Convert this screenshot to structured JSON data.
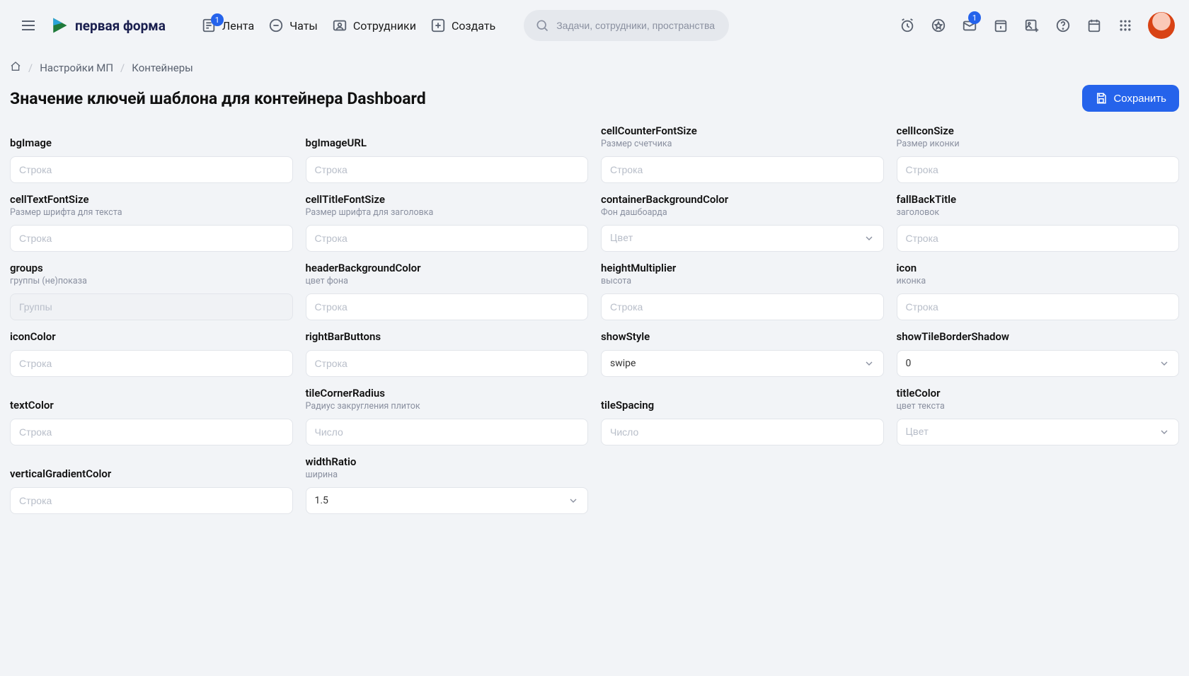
{
  "brand": {
    "name": "первая форма"
  },
  "nav": {
    "feed": {
      "label": "Лента",
      "badge": "1"
    },
    "chats": {
      "label": "Чаты"
    },
    "people": {
      "label": "Сотрудники"
    },
    "create": {
      "label": "Создать"
    }
  },
  "search": {
    "placeholder": "Задачи, сотрудники, пространства"
  },
  "inboxBadge": "1",
  "crumbs": {
    "mp": "Настройки МП",
    "containers": "Контейнеры"
  },
  "page": {
    "title": "Значение ключей шаблона для контейнера Dashboard",
    "saveLabel": "Сохранить"
  },
  "ph": {
    "string": "Строка",
    "number": "Число",
    "color": "Цвет",
    "groups": "Группы"
  },
  "fields": {
    "bgImage": {
      "label": "bgImage"
    },
    "bgImageURL": {
      "label": "bgImageURL"
    },
    "cellCounterFontSize": {
      "label": "cellCounterFontSize",
      "sub": "Размер счетчика"
    },
    "cellIconSize": {
      "label": "cellIconSize",
      "sub": "Размер иконки"
    },
    "cellTextFontSize": {
      "label": "cellTextFontSize",
      "sub": "Размер шрифта для текста"
    },
    "cellTitleFontSize": {
      "label": "cellTitleFontSize",
      "sub": "Размер шрифта для заголовка"
    },
    "containerBackgroundColor": {
      "label": "containerBackgroundColor",
      "sub": "Фон дашбоарда"
    },
    "fallBackTitle": {
      "label": "fallBackTitle",
      "sub": "заголовок"
    },
    "groups": {
      "label": "groups",
      "sub": "группы (не)показа"
    },
    "headerBackgroundColor": {
      "label": "headerBackgroundColor",
      "sub": "цвет фона"
    },
    "heightMultiplier": {
      "label": "heightMultiplier",
      "sub": "высота"
    },
    "icon": {
      "label": "icon",
      "sub": "иконка"
    },
    "iconColor": {
      "label": "iconColor"
    },
    "rightBarButtons": {
      "label": "rightBarButtons"
    },
    "showStyle": {
      "label": "showStyle",
      "value": "swipe"
    },
    "showTileBorderShadow": {
      "label": "showTileBorderShadow",
      "value": "0"
    },
    "textColor": {
      "label": "textColor"
    },
    "tileCornerRadius": {
      "label": "tileCornerRadius",
      "sub": "Радиус закругления плиток"
    },
    "tileSpacing": {
      "label": "tileSpacing"
    },
    "titleColor": {
      "label": "titleColor",
      "sub": "цвет текста"
    },
    "verticalGradientColor": {
      "label": "verticalGradientColor"
    },
    "widthRatio": {
      "label": "widthRatio",
      "sub": "ширина",
      "value": "1.5"
    }
  }
}
